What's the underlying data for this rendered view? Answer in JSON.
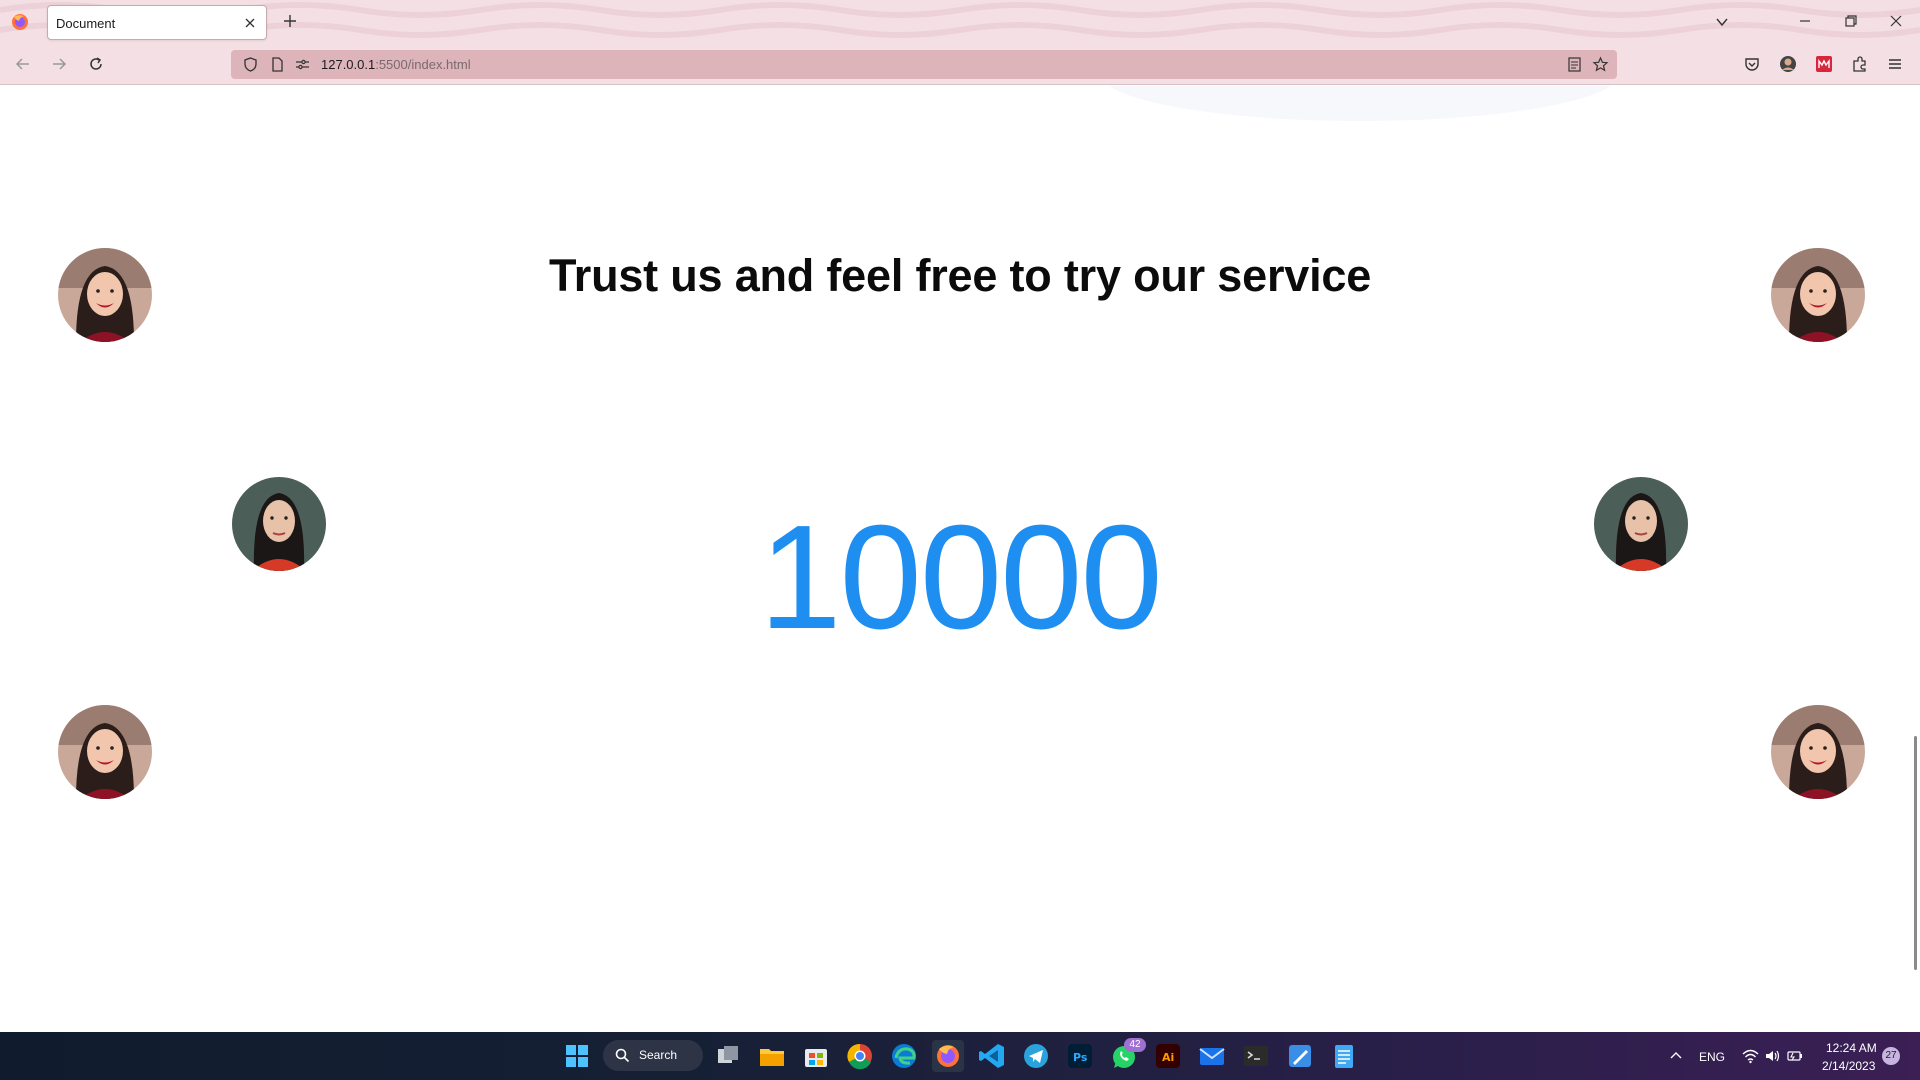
{
  "browser": {
    "tab_title": "Document",
    "url_host": "127.0.0.1",
    "url_rest": ":5500/index.html"
  },
  "page": {
    "heading": "Trust us and feel free to try our service",
    "counter": "10000"
  },
  "taskbar": {
    "search_label": "Search",
    "whatsapp_badge": "42",
    "language": "ENG",
    "time": "12:24 AM",
    "date": "2/14/2023",
    "notification_count": "27"
  }
}
